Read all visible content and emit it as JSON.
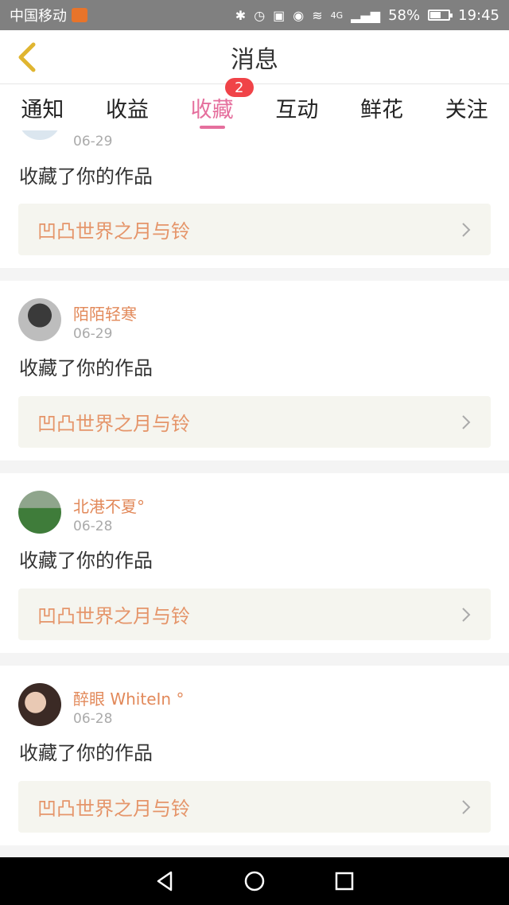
{
  "status_bar": {
    "carrier": "中国移动",
    "network": "4G",
    "battery": "58%",
    "battery_level": 0.58,
    "time": "19:45"
  },
  "header": {
    "title": "消息",
    "back_icon": "chevron-left-icon"
  },
  "tabs": [
    {
      "label": "通知",
      "active": false
    },
    {
      "label": "收益",
      "active": false
    },
    {
      "label": "收藏",
      "active": true,
      "badge": "2"
    },
    {
      "label": "互动",
      "active": false
    },
    {
      "label": "鲜花",
      "active": false
    },
    {
      "label": "关注",
      "active": false
    }
  ],
  "items": [
    {
      "user": "",
      "date": "06-29",
      "action": "收藏了你的作品",
      "work": "凹凸世界之月与铃"
    },
    {
      "user": "陌陌轻寒",
      "date": "06-29",
      "action": "收藏了你的作品",
      "work": "凹凸世界之月与铃"
    },
    {
      "user": "北港不夏°",
      "date": "06-28",
      "action": "收藏了你的作品",
      "work": "凹凸世界之月与铃"
    },
    {
      "user": "醉眼 WhiteIn °",
      "date": "06-28",
      "action": "收藏了你的作品",
      "work": "凹凸世界之月与铃"
    }
  ],
  "colors": {
    "accent_pink": "#e56f9d",
    "username_orange": "#e2895a",
    "work_orange": "#e5956a",
    "badge_red": "#f04348"
  }
}
